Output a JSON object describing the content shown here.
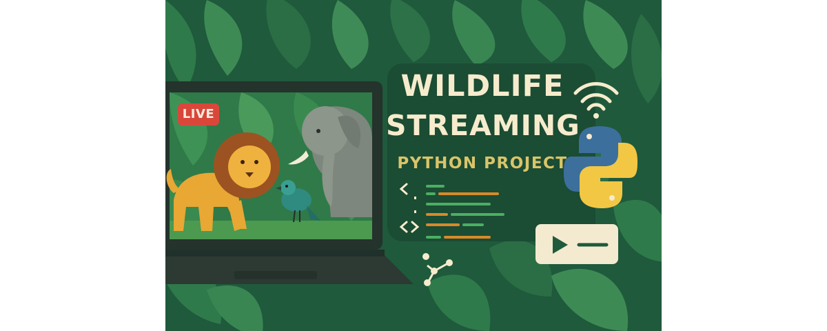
{
  "banner": {
    "title_line_1": "WILDLIFE",
    "title_line_2": "STREAMING",
    "subtitle": "PYTHON PROJECT",
    "live_badge": "LIVE"
  },
  "colors": {
    "background": "#1f5a3c",
    "title": "#f6eccd",
    "subtitle": "#d9c46a",
    "live_badge": "#d9473b",
    "python_blue": "#3c6f9c",
    "python_yellow": "#f2c744"
  },
  "icons": [
    "wifi-icon",
    "python-logo-icon",
    "code-brackets-icon",
    "network-nodes-icon",
    "play-button-icon"
  ]
}
